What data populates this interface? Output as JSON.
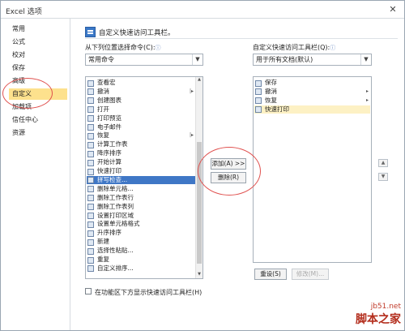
{
  "window": {
    "title": "Excel 选项",
    "close_glyph": "✕"
  },
  "sidebar": {
    "items": [
      {
        "label": "常用"
      },
      {
        "label": "公式"
      },
      {
        "label": "校对"
      },
      {
        "label": "保存"
      },
      {
        "label": "高级"
      },
      {
        "label": "自定义",
        "selected": true
      },
      {
        "label": "加载项"
      },
      {
        "label": "信任中心"
      },
      {
        "label": "资源"
      }
    ]
  },
  "main": {
    "header_text": "自定义快速访问工具栏。",
    "choose_label": "从下列位置选择命令(C):",
    "choose_value": "常用命令",
    "customize_label": "自定义快速访问工具栏(Q):",
    "customize_value": "用于所有文档(默认)",
    "info_glyph": "ⓘ",
    "left_list": [
      {
        "label": "查看宏",
        "icon": "macro-icon"
      },
      {
        "label": "撤消",
        "icon": "undo-icon",
        "sub": "|▸"
      },
      {
        "label": "创建图表",
        "icon": "chart-icon"
      },
      {
        "label": "打开",
        "icon": "open-folder-icon"
      },
      {
        "label": "打印预览",
        "icon": "print-preview-icon"
      },
      {
        "label": "电子邮件",
        "icon": "email-icon"
      },
      {
        "label": "恢复",
        "icon": "redo-icon",
        "sub": "|▸"
      },
      {
        "label": "计算工作表",
        "icon": "calc-sheet-icon"
      },
      {
        "label": "降序排序",
        "icon": "sort-desc-icon"
      },
      {
        "label": "开始计算",
        "icon": "calc-icon"
      },
      {
        "label": "快速打印",
        "icon": "quick-print-icon"
      },
      {
        "label": "拼写检查...",
        "icon": "spell-check-icon",
        "highlight": true
      },
      {
        "label": "删除单元格...",
        "icon": "delete-cells-icon"
      },
      {
        "label": "删除工作表行",
        "icon": "delete-rows-icon"
      },
      {
        "label": "删除工作表列",
        "icon": "delete-cols-icon"
      },
      {
        "label": "设置打印区域",
        "icon": "print-area-icon"
      },
      {
        "label": "设置单元格格式",
        "icon": "format-cells-icon"
      },
      {
        "label": "升序排序",
        "icon": "sort-asc-icon"
      },
      {
        "label": "新建",
        "icon": "new-doc-icon"
      },
      {
        "label": "选择性粘贴...",
        "icon": "paste-special-icon"
      },
      {
        "label": "重复",
        "icon": "repeat-icon"
      },
      {
        "label": "自定义排序...",
        "icon": "custom-sort-icon"
      }
    ],
    "right_list": [
      {
        "label": "保存",
        "icon": "save-icon"
      },
      {
        "label": "撤消",
        "icon": "undo-icon",
        "sub": "▸"
      },
      {
        "label": "恢复",
        "icon": "redo-icon",
        "sub": "▸"
      },
      {
        "label": "快速打印",
        "icon": "quick-print-icon",
        "selected": true
      }
    ],
    "add_button": "添加(A) >>",
    "remove_button": "删除(R)",
    "reset_button": "重设(S)",
    "modify_button": "修改(M)...",
    "checkbox_label": "在功能区下方显示快速访问工具栏(H)",
    "up_arrow": "▲",
    "down_arrow": "▼"
  },
  "watermark": {
    "url": "jb51.net",
    "brand": "脚本之家"
  },
  "colors": {
    "selected_sidebar": "#fde18d",
    "highlight": "#3f77c6",
    "annotation": "#e0514f"
  }
}
